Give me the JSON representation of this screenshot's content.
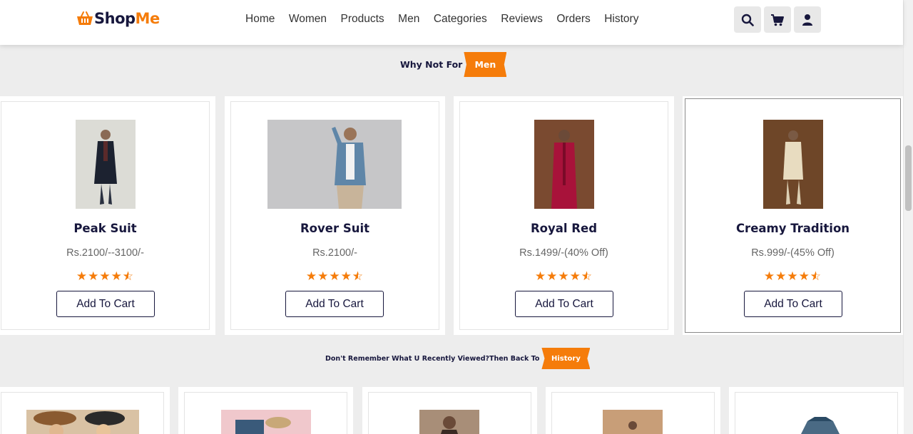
{
  "brand": {
    "part1": "Shop",
    "part2": "Me"
  },
  "nav": [
    "Home",
    "Women",
    "Products",
    "Men",
    "Categories",
    "Reviews",
    "Orders",
    "History"
  ],
  "header_icons": [
    "search-icon",
    "cart-icon",
    "user-icon"
  ],
  "section_men": {
    "label": "Why Not For",
    "tag": "Men"
  },
  "products": [
    {
      "name": "Peak Suit",
      "price": "Rs.2100/--3100/-",
      "rating": 4.5,
      "button": "Add To Cart"
    },
    {
      "name": "Rover Suit",
      "price": "Rs.2100/-",
      "rating": 4.5,
      "button": "Add To Cart"
    },
    {
      "name": "Royal Red",
      "price": "Rs.1499/-(40% Off)",
      "rating": 4.5,
      "button": "Add To Cart"
    },
    {
      "name": "Creamy Tradition",
      "price": "Rs.999/-(45% Off)",
      "rating": 4.5,
      "button": "Add To Cart"
    }
  ],
  "section_history": {
    "label": "Don't Remember What U Recently Viewed?Then Back To",
    "tag": "History"
  },
  "colors": {
    "accent": "#f57c0a",
    "navy": "#17173d",
    "background": "#ededed"
  }
}
